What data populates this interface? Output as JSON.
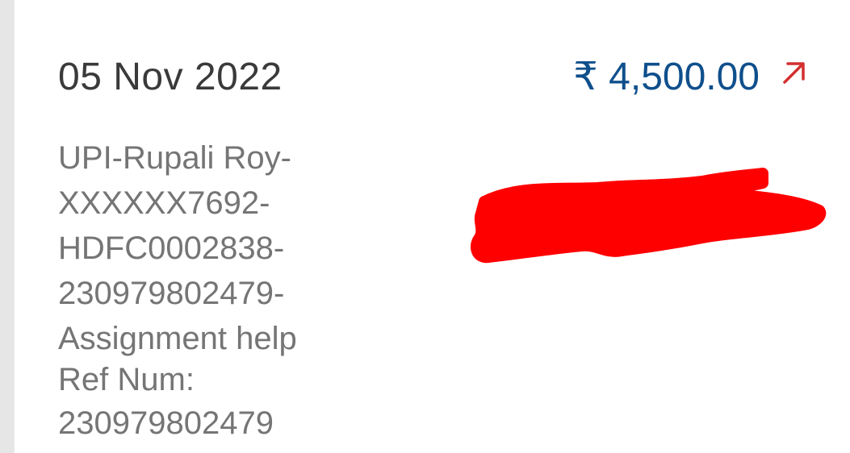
{
  "transaction": {
    "date": "05 Nov 2022",
    "amount": "₹ 4,500.00",
    "direction_icon": "arrow-up-right-icon",
    "description_lines": [
      "UPI-Rupali Roy-",
      "XXXXXX7692-",
      "HDFC0002838-",
      "230979802479-",
      "Assignment help"
    ],
    "ref_label": "Ref Num:",
    "ref_value": "230979802479"
  },
  "colors": {
    "amount": "#0f4f8c",
    "arrow": "#d32f2f",
    "redaction": "#ff0000",
    "date_text": "#3a3a3a",
    "secondary_text": "#757575"
  }
}
